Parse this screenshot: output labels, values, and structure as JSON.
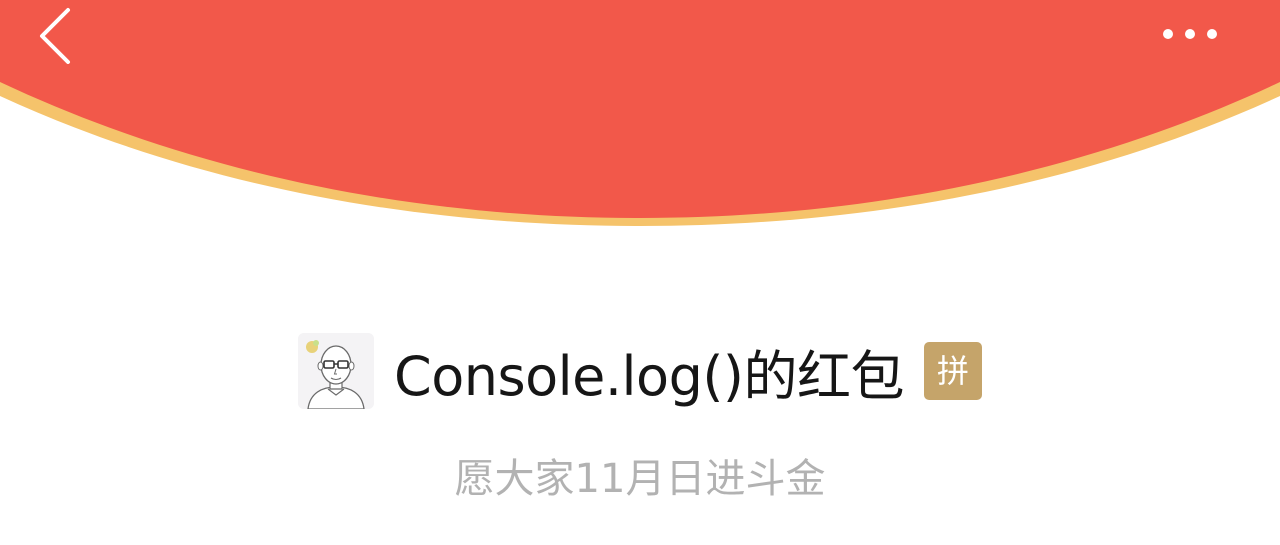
{
  "header": {
    "back_icon": "chevron-left-icon",
    "more_icon": "more-dots-icon",
    "banner_color": "#F2584A",
    "banner_edge_color": "#F5C36B"
  },
  "envelope": {
    "avatar_icon": "avatar-portrait-icon",
    "title": "Console.log()的红包",
    "badge_label": "拼",
    "badge_color": "#C5A46A",
    "subtitle": "愿大家11月日进斗金"
  }
}
